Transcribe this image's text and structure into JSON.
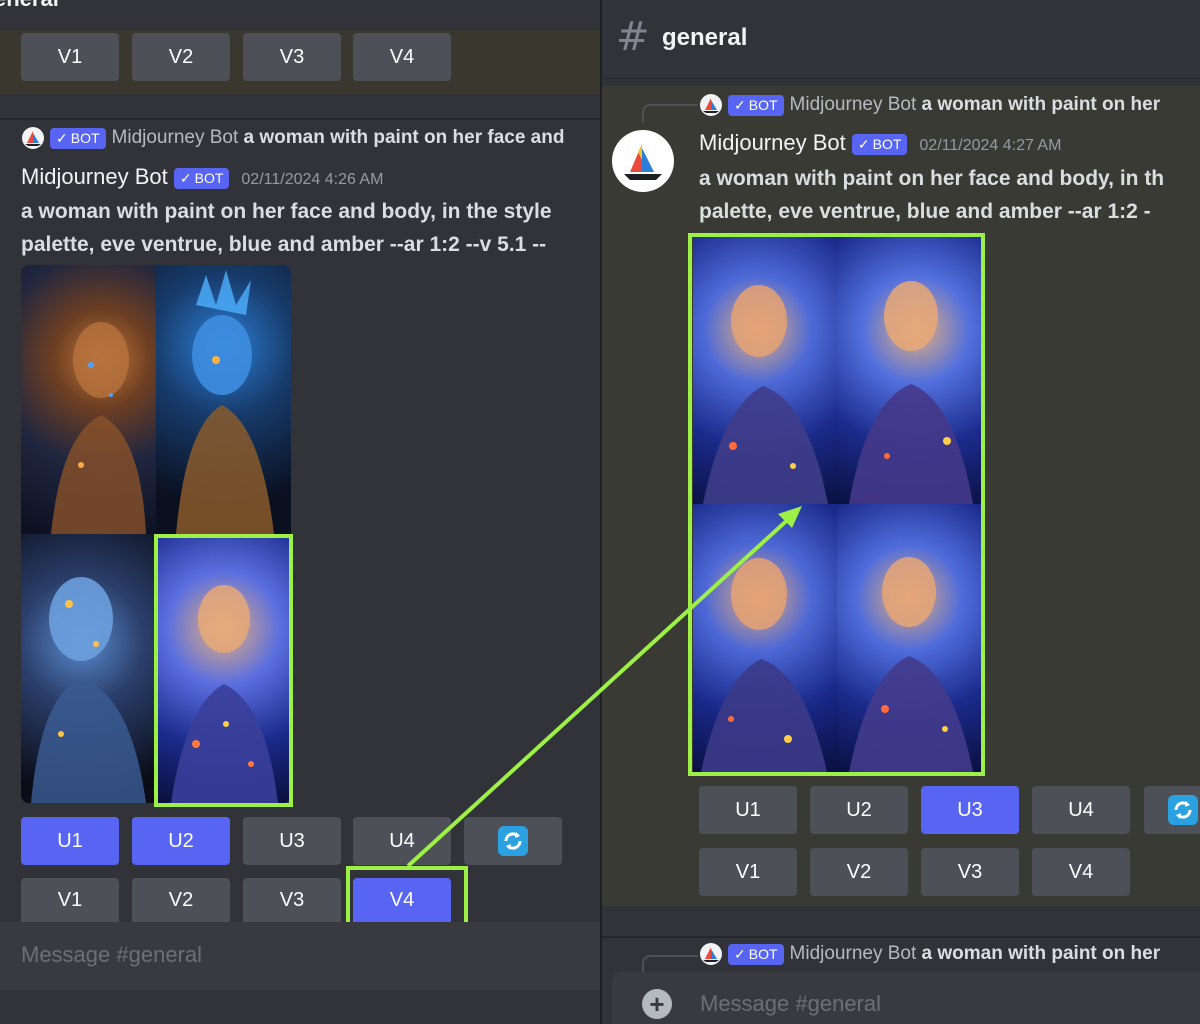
{
  "left": {
    "header_fragment": "eneral",
    "top_variation_buttons": [
      "V1",
      "V2",
      "V3",
      "V4"
    ],
    "reply": {
      "badge": "BOT",
      "name": "Midjourney Bot",
      "snippet": "a woman with paint on her face and"
    },
    "author": "Midjourney Bot",
    "badge": "BOT",
    "timestamp": "02/11/2024 4:26 AM",
    "content_line1": "a woman with paint on her face and body, in the style",
    "content_line2": "palette, eve ventrue, blue and amber --ar 1:2 --v 5.1 --",
    "upscale_buttons": [
      "U1",
      "U2",
      "U3",
      "U4"
    ],
    "variation_buttons": [
      "V1",
      "V2",
      "V3",
      "V4"
    ],
    "composer_placeholder": "Message #general"
  },
  "right": {
    "channel": "general",
    "reply": {
      "badge": "BOT",
      "name": "Midjourney Bot",
      "snippet": "a woman with paint on her"
    },
    "author": "Midjourney Bot",
    "badge": "BOT",
    "timestamp": "02/11/2024 4:27 AM",
    "content_line1": "a woman with paint on her face and body, in th",
    "content_line2": "palette, eve ventrue, blue and amber --ar 1:2 -",
    "upscale_buttons": [
      "U1",
      "U2",
      "U3",
      "U4"
    ],
    "variation_buttons": [
      "V1",
      "V2",
      "V3",
      "V4"
    ],
    "next_reply": {
      "badge": "BOT",
      "name": "Midjourney Bot",
      "snippet": "a woman with paint on her"
    },
    "composer_placeholder": "Message #general"
  },
  "colors": {
    "background": "#313338",
    "button_secondary": "#4e5058",
    "button_primary": "#5865f2",
    "highlight": "#9cf046"
  },
  "icons": [
    "hashtag-icon",
    "refresh-icon",
    "plus-icon",
    "check-icon",
    "sailboat-logo-icon"
  ]
}
